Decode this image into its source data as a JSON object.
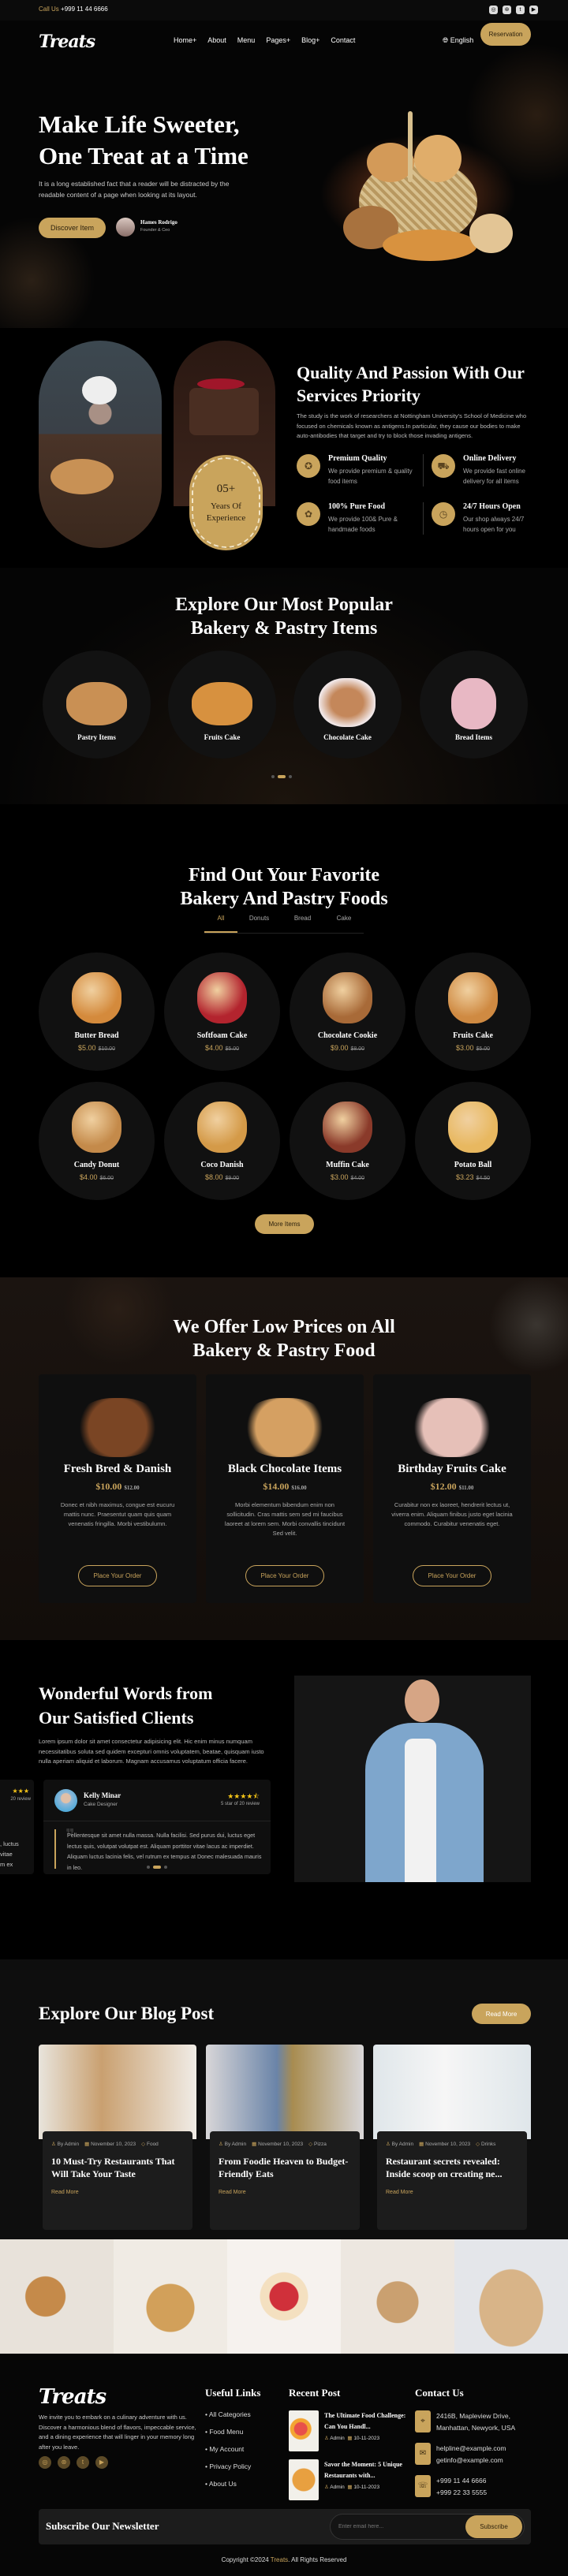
{
  "colors": {
    "accent": "#c9a45c",
    "background": "#000000",
    "card": "#111111"
  },
  "topbar": {
    "call_label": "Call Us",
    "phone": "+999 11 44 6666",
    "social": [
      "instagram-icon",
      "dribbble-icon",
      "twitter-icon",
      "youtube-icon"
    ]
  },
  "nav": {
    "logo": "Treats",
    "items": [
      "Home+",
      "About",
      "Menu",
      "Pages+",
      "Blog+",
      "Contact"
    ],
    "language": "English",
    "reservation": "Reservation"
  },
  "hero": {
    "title_line1": "Make Life Sweeter,",
    "title_line2": "One Treat at a Time",
    "text": "It is a long established fact that a reader will be distracted by the readable content of a page when looking at its layout.",
    "button": "Discover Item",
    "author_name": "Hames Rodrigo",
    "author_role": "Founder & Ceo"
  },
  "about": {
    "badge_number": "05+",
    "badge_text": "Years Of Experience",
    "title": "Quality And Passion With Our Services Priority",
    "text": "The study is the work of researchers at Nottingham University's School of Medicine who focused on chemicals known as antigens.In particular, they cause our bodies to make auto-antibodies that target and try to block those invading antigens.",
    "features": [
      {
        "title": "Premium Quality",
        "text": "We provide premium & quality food items",
        "icon": "medal-icon"
      },
      {
        "title": "Online Delivery",
        "text": "We provide fast online delivery for all items",
        "icon": "delivery-icon"
      },
      {
        "title": "100% Pure Food",
        "text": "We provide 100& Pure & handmade foods",
        "icon": "pure-food-icon"
      },
      {
        "title": "24/7 Hours Open",
        "text": "Our shop always 24/7 hours open for you",
        "icon": "clock-icon"
      }
    ]
  },
  "popular": {
    "title_line1": "Explore Our Most Popular",
    "title_line2": "Bakery & Pastry Items",
    "items": [
      "Pastry Items",
      "Fruits Cake",
      "Chocolate Cake",
      "Bread Items"
    ]
  },
  "menu": {
    "title_line1": "Find Out Your Favorite",
    "title_line2": "Bakery And Pastry Foods",
    "tabs": [
      "All",
      "Donuts",
      "Bread",
      "Cake"
    ],
    "active_tab": "All",
    "items": [
      {
        "name": "Butter Bread",
        "price": "$5.00",
        "old": "$10.00"
      },
      {
        "name": "Softfoam Cake",
        "price": "$4.00",
        "old": "$5.00"
      },
      {
        "name": "Chocolate Cookie",
        "price": "$9.00",
        "old": "$8.00"
      },
      {
        "name": "Fruits Cake",
        "price": "$3.00",
        "old": "$5.00"
      },
      {
        "name": "Candy Donut",
        "price": "$4.00",
        "old": "$6.00"
      },
      {
        "name": "Coco Danish",
        "price": "$8.00",
        "old": "$9.00"
      },
      {
        "name": "Muffin Cake",
        "price": "$3.00",
        "old": "$4.00"
      },
      {
        "name": "Potato Ball",
        "price": "$3.23",
        "old": "$4.50"
      }
    ],
    "more_button": "More Items"
  },
  "offers": {
    "title_line1": "We Offer Low Prices on All",
    "title_line2": "Bakery & Pastry Food",
    "button": "Place Your Order",
    "items": [
      {
        "name": "Fresh Bred & Danish",
        "price": "$10.00",
        "old": "$12.00",
        "text": "Donec et nibh maximus, congue est eucuru mattis nunc. Praesentut quam quis quam venenatis fringilla. Morbi vestibulumn."
      },
      {
        "name": "Black Chocolate Items",
        "price": "$14.00",
        "old": "$16.00",
        "text": "Morbi elementum bibendum enim non sollicitudin. Cras mattis sem sed mi faucibus laoreet at lorem sem. Morbi convallis tincidunt Sed velit."
      },
      {
        "name": "Birthday Fruits Cake",
        "price": "$12.00",
        "old": "$11.00",
        "text": "Curabitur non ex laoreet, hendrerit lectus ut, viverra enim. Aliquam finibus justo eget lacinia commodo. Curabitur venenatis eget."
      }
    ]
  },
  "testimonials": {
    "title_line1": "Wonderful Words from",
    "title_line2": "Our Satisfied Clients",
    "text": "Lorem ipsum dolor sit amet consectetur adipisicing elit. Hic enim minus numquam necessitatibus soluta sed quidem excepturi omnis voluptatem, beatae, quisquam iusto nulla aperiam aliquid et laborum. Magnam accusamus voluptatum officia facere.",
    "card": {
      "name": "Kelly Minar",
      "role": "Cake Designer",
      "rating": 4.5,
      "rating_text": "5 star of 20 review",
      "quote": "Pellentesque sit amet nulla massa. Nulla facilisi. Sed purus dui, luctus eget lectus quis, volutpat volutpat est. Aliquam porttitor vitae lacus ac imperdiet. Aliquam luctus lacinia felis, vel rutrum ex tempus at Donec malesuada mauris in leo."
    },
    "prev_card": {
      "rating_text": "20 review",
      "quote": ", luctus\nvitae\nm ex"
    }
  },
  "blog": {
    "title": "Explore Our Blog Post",
    "button": "Read More",
    "posts": [
      {
        "author": "By Admin",
        "date": "November 10, 2023",
        "tag": "Food",
        "title": "10 Must-Try Restaurants That Will Take Your Taste",
        "link": "Read More"
      },
      {
        "author": "By Admin",
        "date": "November 10, 2023",
        "tag": "Pizza",
        "title": "From Foodie Heaven to Budget-Friendly Eats",
        "link": "Read More"
      },
      {
        "author": "By Admin",
        "date": "November 10, 2023",
        "tag": "Drinks",
        "title": "Restaurant secrets revealed: Inside scoop on creating ne...",
        "link": "Read More"
      }
    ]
  },
  "footer": {
    "logo": "Treats",
    "about": "We invite you to embark on a culinary adventure with us. Discover a harmonious blend of flavors, impeccable service, and a dining experience that will linger in your memory long after you leave.",
    "useful_title": "Useful Links",
    "useful": [
      "All Categories",
      "Food Menu",
      "My Account",
      "Privacy Policy",
      "About Us"
    ],
    "recent_title": "Recent Post",
    "recent": [
      {
        "title": "The Ultimate Food Challenge: Can You Handl...",
        "author": "Admin",
        "date": "10-11-2023"
      },
      {
        "title": "Savor the Moment: 5 Unique Restaurants with...",
        "author": "Admin",
        "date": "10-11-2023"
      }
    ],
    "contact_title": "Contact Us",
    "address": "2416B, Mapleview Drive, Manhattan, Newyork, USA",
    "email1": "helpline@example.com",
    "email2": "getinfo@example.com",
    "phone1": "+999 11 44 6666",
    "phone2": "+999 22 33 5555",
    "newsletter_title": "Subscribe Our Newsletter",
    "email_placeholder": "Enter email here...",
    "subscribe": "Subscribe",
    "copyright_pre": "Copyright ©2024 ",
    "copyright_brand": "Treats",
    "copyright_post": ". All Rights Reserved"
  }
}
